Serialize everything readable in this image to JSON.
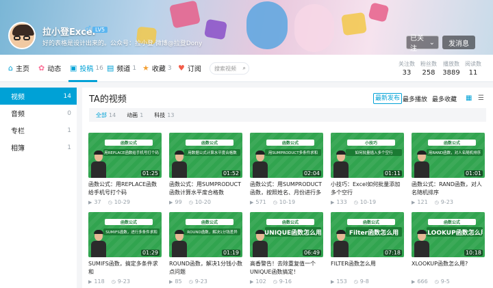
{
  "header": {
    "username": "拉小登Excel",
    "gender_icon": "♂",
    "level": "LV5",
    "signature": "好的表格是设计出来的。公众号：拉小登 微博@拉登Dony",
    "follow_label": "已关注",
    "message_label": "发消息"
  },
  "nav": {
    "items": [
      {
        "label": "主页",
        "count": "",
        "icon": "home-icon"
      },
      {
        "label": "动态",
        "count": "",
        "icon": "activity-icon"
      },
      {
        "label": "投稿",
        "count": "16",
        "icon": "video-icon"
      },
      {
        "label": "频道",
        "count": "1",
        "icon": "channel-icon"
      },
      {
        "label": "收藏",
        "count": "3",
        "icon": "star-icon"
      },
      {
        "label": "订阅",
        "count": "",
        "icon": "heart-icon"
      }
    ],
    "search_placeholder": "搜索视频",
    "stats": [
      {
        "label": "关注数",
        "value": "33"
      },
      {
        "label": "粉丝数",
        "value": "258"
      },
      {
        "label": "播放数",
        "value": "3889"
      },
      {
        "label": "阅读数",
        "value": "11"
      }
    ]
  },
  "sidebar": {
    "items": [
      {
        "label": "视频",
        "count": "14"
      },
      {
        "label": "音频",
        "count": "0"
      },
      {
        "label": "专栏",
        "count": "1"
      },
      {
        "label": "相簿",
        "count": "1"
      }
    ]
  },
  "main": {
    "title": "TA的视频",
    "sort": [
      "最新发布",
      "最多播放",
      "最多收藏"
    ],
    "filters": [
      {
        "label": "全部",
        "count": "14"
      },
      {
        "label": "动画",
        "count": "1"
      },
      {
        "label": "科技",
        "count": "13"
      }
    ],
    "videos": [
      {
        "title": "函数公式：用REPLACE函数给手机号打个码",
        "duration": "01:25",
        "plays": "37",
        "date": "10-29",
        "tag": "函数公式",
        "banner": "用REPLACE函数给手机号打个码"
      },
      {
        "title": "函数公式：用SUMPRODUCT函数计算水平度合格数",
        "duration": "01:52",
        "plays": "99",
        "date": "10-20",
        "tag": "函数公式",
        "banner": "用数据公式计算水平度合格数"
      },
      {
        "title": "函数公式：用SUMPRODUCT函数，按照姓名、月份进行多条件求",
        "duration": "02:04",
        "plays": "571",
        "date": "10-19",
        "tag": "函数公式",
        "banner": "用SUMPRODUCT多条件求和"
      },
      {
        "title": "小技巧：Excel如何批量添加多个空行",
        "duration": "01:11",
        "plays": "133",
        "date": "10-19",
        "tag": "小技巧",
        "banner": "如何批量插入多个空行"
      },
      {
        "title": "函数公式：RAND函数，对人名随机排序",
        "duration": "01:01",
        "plays": "121",
        "date": "9-23",
        "tag": "函数公式",
        "banner": "用RAND函数，对人名随机排序"
      },
      {
        "title": "SUMIFS函数，搞定多条件求和",
        "duration": "01:29",
        "plays": "118",
        "date": "9-23",
        "tag": "函数公式",
        "banner": "SUMIFS函数，进行多条件求和"
      },
      {
        "title": "ROUND函数，解决1分钱小数点问题",
        "duration": "01:19",
        "plays": "85",
        "date": "9-23",
        "tag": "函数公式",
        "banner": "ROUND函数，解决1分钱差异"
      },
      {
        "title": "高香警告！去除重复值一个UNIQUE函数搞定！",
        "duration": "06:49",
        "plays": "102",
        "date": "9-16",
        "tag": "函数公式",
        "banner": "UNIQUE函数怎么用"
      },
      {
        "title": "FILTER函数怎么用",
        "duration": "07:18",
        "plays": "153",
        "date": "9-8",
        "tag": "函数公式",
        "banner": "Filter函数怎么用"
      },
      {
        "title": "XLOOKUP函数怎么用?",
        "duration": "10:18",
        "plays": "666",
        "date": "9-5",
        "tag": "函数公式",
        "banner": "XLOOKUP函数怎么用"
      }
    ]
  },
  "colors": {
    "accent": "#00a1d6",
    "thumb_green": "#31a44f"
  }
}
